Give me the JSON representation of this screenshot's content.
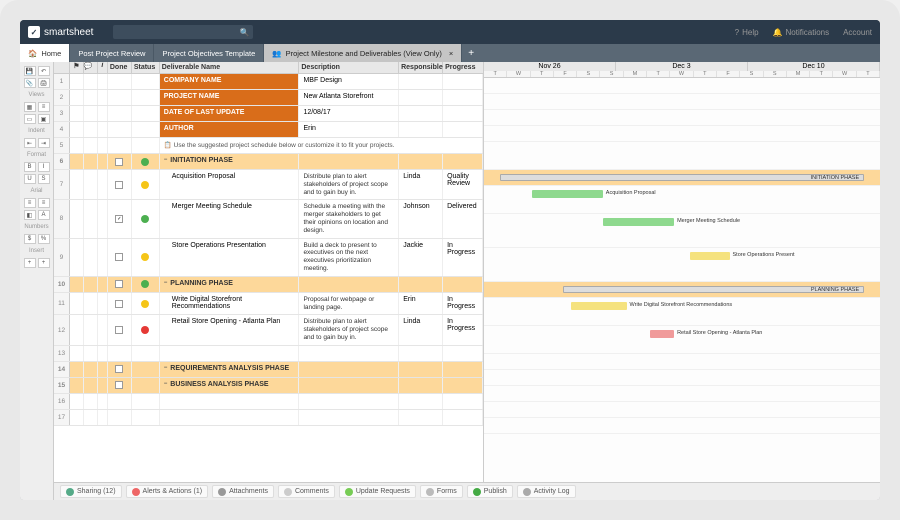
{
  "brand": {
    "name": "smartsheet",
    "mark": "✓"
  },
  "topbar": {
    "help": "Help",
    "notifications": "Notifications",
    "account": "Account"
  },
  "tabs": {
    "home": "Home",
    "items": [
      {
        "label": "Post Project Review"
      },
      {
        "label": "Project Objectives Template"
      },
      {
        "label": "Project Milestone and Deliverables (View Only)",
        "active": true
      }
    ]
  },
  "side": {
    "views": "Views",
    "indent": "Indent",
    "format": "Format",
    "font": "Arial",
    "numbers": "Numbers",
    "insert": "Insert"
  },
  "columns": {
    "done": "Done",
    "status": "Status",
    "name": "Deliverable Name",
    "desc": "Description",
    "resp": "Responsible",
    "prog": "Progress"
  },
  "meta": [
    {
      "label": "COMPANY NAME",
      "value": "MBF Design"
    },
    {
      "label": "PROJECT NAME",
      "value": "New Atlanta Storefront"
    },
    {
      "label": "DATE OF LAST UPDATE",
      "value": "12/08/17"
    },
    {
      "label": "AUTHOR",
      "value": "Erin"
    }
  ],
  "note": "Use the suggested project schedule below or customize it to fit your projects.",
  "rows": [
    {
      "num": 6,
      "type": "phase",
      "name": "INITIATION PHASE",
      "status": "green"
    },
    {
      "num": 7,
      "type": "task",
      "name": "Acquisition Proposal",
      "desc": "Distribute plan to alert stakeholders of project scope and to gain buy in.",
      "resp": "Linda",
      "prog": "Quality Review",
      "status": "yellow"
    },
    {
      "num": 8,
      "type": "task",
      "name": "Merger Meeting Schedule",
      "desc": "Schedule a meeting with the merger stakeholders to get their opinions on location and design.",
      "resp": "Johnson",
      "prog": "Delivered",
      "status": "green",
      "done": true
    },
    {
      "num": 9,
      "type": "task",
      "name": "Store Operations Presentation",
      "desc": "Build a deck to present to executives on the next executives prioritization meeting.",
      "resp": "Jackie",
      "prog": "In Progress",
      "status": "yellow"
    },
    {
      "num": 10,
      "type": "phase",
      "name": "PLANNING PHASE",
      "status": "green"
    },
    {
      "num": 11,
      "type": "task",
      "name": "Write Digital Storefront Recommendations",
      "desc": "Proposal for webpage or landing page.",
      "resp": "Erin",
      "prog": "In Progress",
      "status": "yellow"
    },
    {
      "num": 12,
      "type": "task",
      "name": "Retail Store Opening - Atlanta Plan",
      "desc": "Distribute plan to alert stakeholders of project scope and to gain buy in.",
      "resp": "Linda",
      "prog": "In Progress",
      "status": "red"
    },
    {
      "num": 13,
      "type": "blank"
    },
    {
      "num": 14,
      "type": "phase",
      "name": "REQUIREMENTS ANALYSIS PHASE"
    },
    {
      "num": 15,
      "type": "phase",
      "name": "BUSINESS ANALYSIS PHASE"
    },
    {
      "num": 16,
      "type": "blank"
    },
    {
      "num": 17,
      "type": "blank"
    }
  ],
  "gantt": {
    "weeks": [
      "Nov 26",
      "Dec 3",
      "Dec 10"
    ],
    "days": [
      "T",
      "W",
      "T",
      "F",
      "S",
      "S",
      "M",
      "T",
      "W",
      "T",
      "F",
      "S",
      "S",
      "M",
      "T",
      "W",
      "T"
    ],
    "bars": {
      "initiation_phase": "INITIATION PHASE",
      "acquisition": "Acquisition Proposal",
      "merger": "Merger Meeting Schedule",
      "store_ops": "Store Operations Present",
      "planning_phase": "PLANNING PHASE",
      "write_digital": "Write Digital Storefront Recommendations",
      "retail_open": "Retail Store Opening - Atlanta Plan"
    }
  },
  "bottom": {
    "sharing": "Sharing  (12)",
    "alerts": "Alerts & Actions  (1)",
    "attachments": "Attachments",
    "comments": "Comments",
    "update": "Update Requests",
    "forms": "Forms",
    "publish": "Publish",
    "activity": "Activity Log"
  }
}
